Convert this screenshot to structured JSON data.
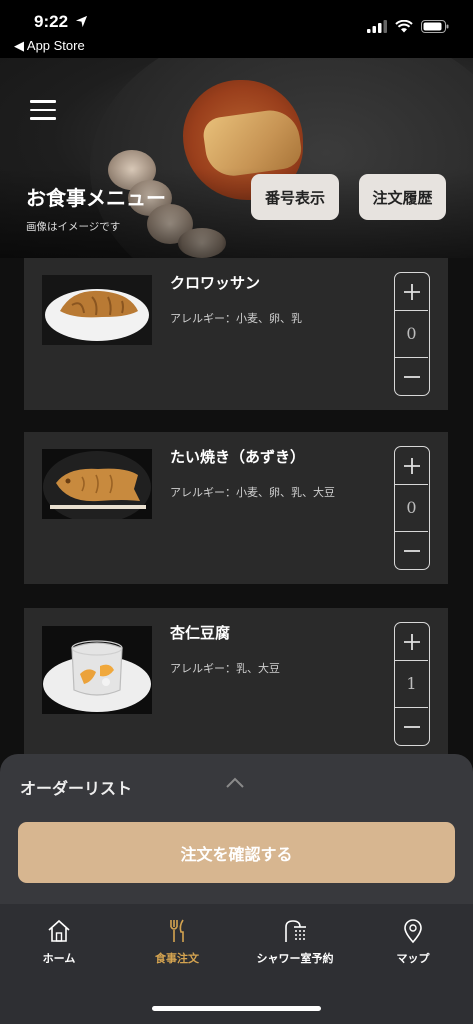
{
  "status_bar": {
    "time": "9:22",
    "back_label": "◀ App Store"
  },
  "header": {
    "title": "お食事メニュー",
    "subtitle": "画像はイメージです",
    "number_button": "番号表示",
    "history_button": "注文履歴"
  },
  "menu_items": [
    {
      "name": "クロワッサン",
      "allergy": "アレルギー：小麦、卵、乳",
      "quantity": "0"
    },
    {
      "name": "たい焼き（あずき）",
      "allergy": "アレルギー：小麦、卵、乳、大豆",
      "quantity": "0"
    },
    {
      "name": "杏仁豆腐",
      "allergy": "アレルギー：乳、大豆",
      "quantity": "1"
    }
  ],
  "order_panel": {
    "title": "オーダーリスト",
    "confirm_button": "注文を確認する"
  },
  "tabs": [
    {
      "label": "ホーム",
      "icon": "home-icon",
      "active": false
    },
    {
      "label": "食事注文",
      "icon": "fork-knife-icon",
      "active": true
    },
    {
      "label": "シャワー室予約",
      "icon": "shower-icon",
      "active": false
    },
    {
      "label": "マップ",
      "icon": "map-pin-icon",
      "active": false
    }
  ],
  "colors": {
    "accent": "#d4a350",
    "confirm_button": "#d7b690",
    "card_bg": "#2a2a2a",
    "panel_bg": "#38393d"
  }
}
